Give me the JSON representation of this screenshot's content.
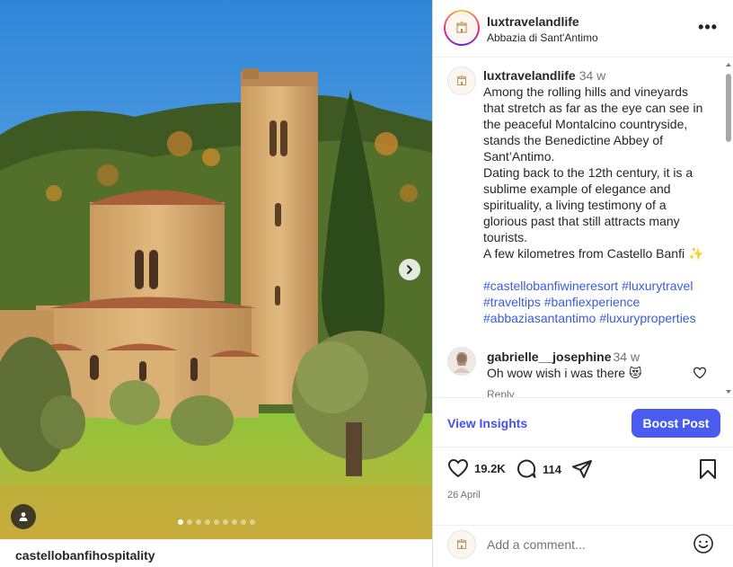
{
  "post": {
    "username": "luxtravelandlife",
    "location": "Abbazia di Sant'Antimo",
    "more_label": "•••",
    "tagged_account": "castellobanfihospitality",
    "carousel": {
      "count": 9,
      "active_index": 0
    }
  },
  "caption": {
    "username": "luxtravelandlife",
    "time": "34 w",
    "lines": [
      "Among the rolling hills and vineyards",
      "that stretch as far as the eye can see in",
      "the peaceful Montalcino countryside,",
      "stands the Benedictine Abbey of",
      "Sant’Antimo.",
      "Dating back to the 12th century, it is a",
      "sublime example of elegance and",
      "spirituality, a living testimony of a",
      "glorious past that still attracts many",
      "tourists.",
      "A few kilometres from Castello Banfi ✨"
    ],
    "hashtags": [
      "#castellobanfiwineresort #luxurytravel",
      "#traveltips #banfiexperience",
      "#abbaziasantantimo #luxuryproperties"
    ]
  },
  "comment": {
    "username": "gabrielle__josephine",
    "time": "34 w",
    "text": "Oh wow wish i was there 😻",
    "reply_label": "Reply"
  },
  "insights": {
    "view_label": "View Insights",
    "boost_label": "Boost Post"
  },
  "actions": {
    "likes": "19.2K",
    "comments": "114",
    "date": "26 April"
  },
  "add_comment": {
    "placeholder": "Add a comment..."
  },
  "colors": {
    "link_blue": "#3b5bdb",
    "boost_bg": "#4a5cf0",
    "insights_text": "#4150f7"
  }
}
